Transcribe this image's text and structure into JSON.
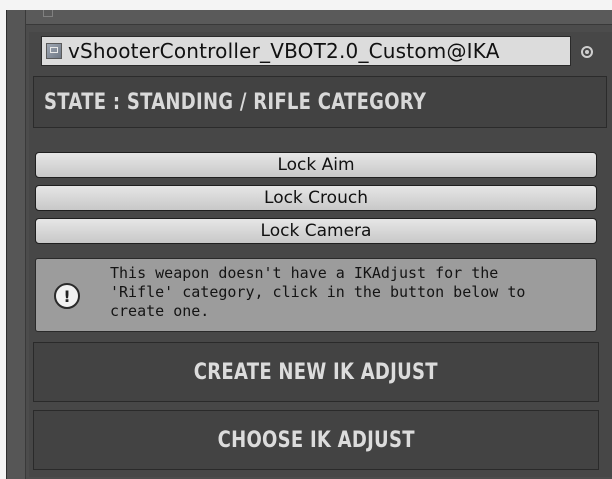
{
  "object_field": {
    "label": "vShooterController_VBOT2.0_Custom@IKA",
    "icon": "prefab-icon"
  },
  "state": {
    "text": "STATE : STANDING  / RIFLE CATEGORY"
  },
  "lock_buttons": [
    {
      "label": "Lock Aim"
    },
    {
      "label": "Lock Crouch"
    },
    {
      "label": "Lock Camera"
    }
  ],
  "help_box": {
    "icon": "exclamation-icon",
    "text": "This weapon doesn't have a IKAdjust for the\n'Rifle' category,  click in the button below to\ncreate one."
  },
  "actions": {
    "create_label": "CREATE NEW IK ADJUST",
    "choose_label": "CHOOSE IK ADJUST"
  },
  "colors": {
    "panel_bg": "#474747",
    "button_face": "#d6d6d6",
    "help_bg": "#9c9c9c",
    "header_text": "#d9d9d9"
  }
}
